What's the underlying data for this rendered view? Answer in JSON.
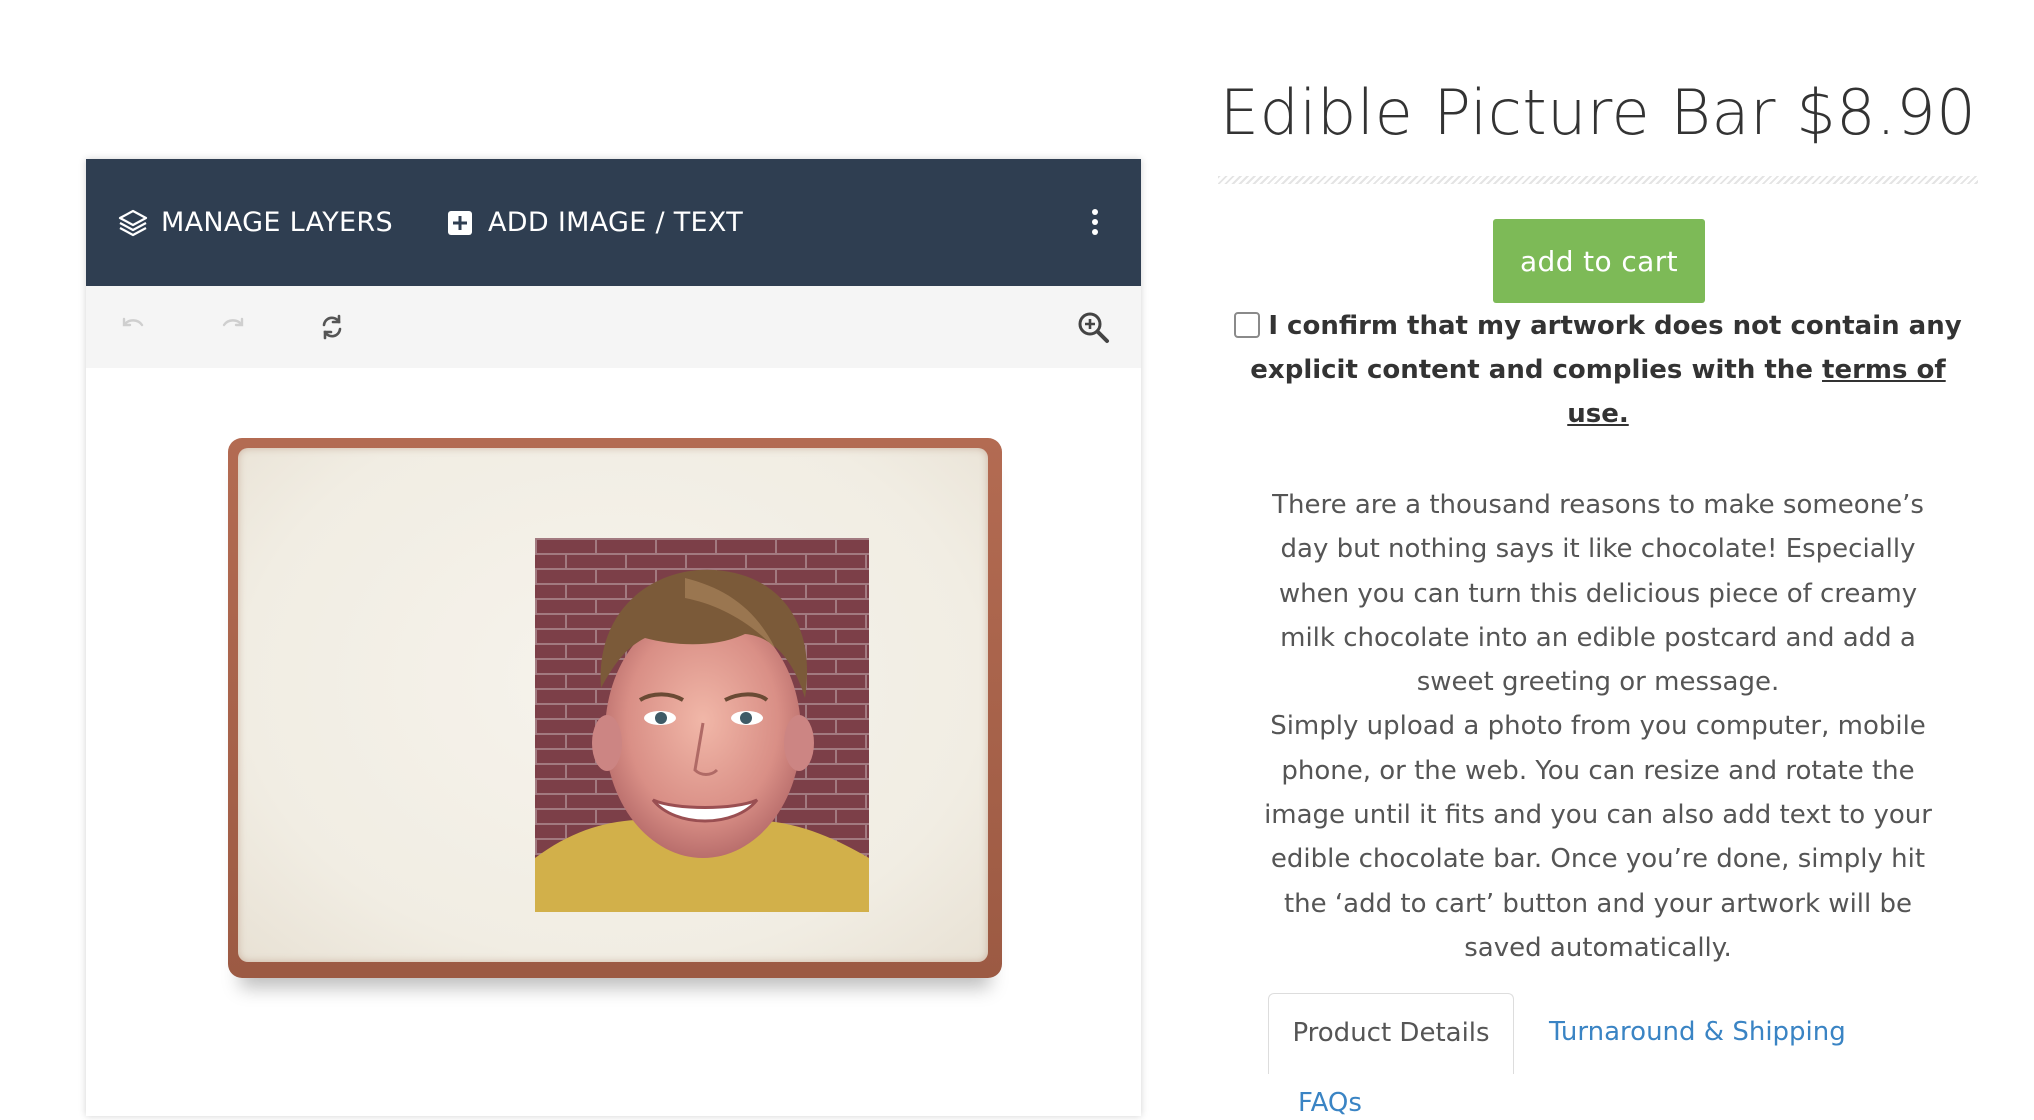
{
  "designer": {
    "toolbar": {
      "manage_layers_label": "MANAGE LAYERS",
      "add_image_text_label": "ADD IMAGE / TEXT",
      "background_color": "#2f3e51"
    },
    "actions": {
      "undo_icon": "undo-icon",
      "redo_icon": "redo-icon",
      "rotate_icon": "refresh-icon",
      "zoom_icon": "zoom-in-icon"
    }
  },
  "product": {
    "title": "Edible Picture Bar $8.90",
    "add_to_cart_label": "add to cart",
    "button_color": "#7dba57",
    "confirm_text": "I confirm that my artwork does not contain any explicit content and complies with the",
    "terms_link_text": "terms of use.",
    "description_1": "There are a thousand reasons to make someone’s day but nothing says it like chocolate! Especially when you can turn this delicious piece of creamy milk chocolate into an edible postcard and add a sweet greeting or message.",
    "description_2": "Simply upload a photo from you computer, mobile phone, or the web. You can resize and rotate the image until it fits and you can also add text to your edible chocolate bar. Once you’re done, simply hit the ‘add to cart’ button and your artwork will be saved automatically.",
    "link_color": "#3a84c4"
  },
  "tabs": [
    {
      "label": "Product Details",
      "active": true
    },
    {
      "label": "Turnaround & Shipping",
      "active": false
    },
    {
      "label": "FAQs",
      "active": false
    }
  ]
}
